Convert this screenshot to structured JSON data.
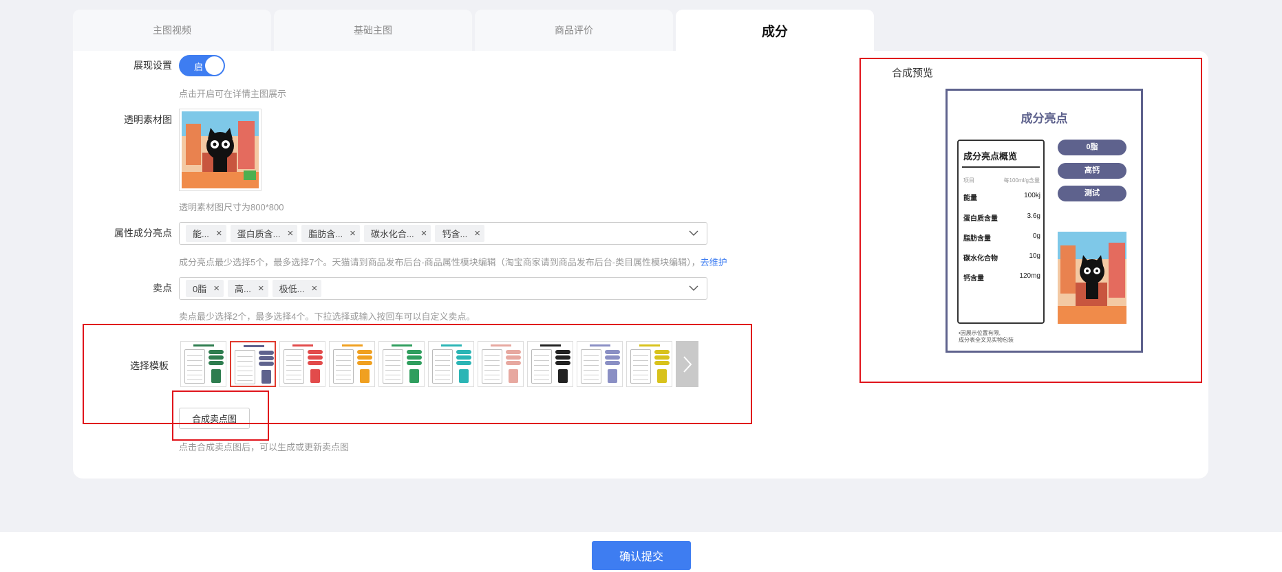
{
  "tabs": [
    {
      "label": "主图视频"
    },
    {
      "label": "基础主图"
    },
    {
      "label": "商品评价"
    },
    {
      "label": "成分",
      "active": true
    }
  ],
  "display": {
    "label": "展现设置",
    "toggle_text": "启",
    "toggle_on": true,
    "hint": "点击开启可在详情主图展示"
  },
  "asset": {
    "label": "透明素材图",
    "hint": "透明素材图尺寸为800*800"
  },
  "attributes": {
    "label": "属性成分亮点",
    "tags": [
      "能...",
      "蛋白质含...",
      "脂肪含...",
      "碳水化合...",
      "钙含..."
    ],
    "hint": "成分亮点最少选择5个，最多选择7个。天猫请到商品发布后台-商品属性模块编辑（淘宝商家请到商品发布后台-类目属性模块编辑），",
    "link": "去维护"
  },
  "selling": {
    "label": "卖点",
    "tags": [
      "0脂",
      "高...",
      "极低..."
    ],
    "hint": "卖点最少选择2个，最多选择4个。下拉选择或输入按回车可以自定义卖点。"
  },
  "template": {
    "label": "选择模板",
    "colors": [
      "#2e7d4f",
      "#5e628d",
      "#e24b4b",
      "#f0a020",
      "#2f9e5e",
      "#2bb5b5",
      "#e7a8a0",
      "#222222",
      "#8a8fc4",
      "#d8c21c"
    ],
    "selected_index": 1
  },
  "compose": {
    "button": "合成卖点图",
    "hint": "点击合成卖点图后，可以生成或更新卖点图"
  },
  "preview": {
    "title": "合成预览",
    "card_title": "成分亮点",
    "table_title": "成分亮点概览",
    "head_left": "项目",
    "head_right": "每100ml/g含量",
    "rows": [
      {
        "name": "能量",
        "value": "100kj"
      },
      {
        "name": "蛋白质含量",
        "value": "3.6g"
      },
      {
        "name": "脂肪含量",
        "value": "0g"
      },
      {
        "name": "碳水化合物",
        "value": "10g"
      },
      {
        "name": "钙含量",
        "value": "120mg"
      }
    ],
    "pills": [
      "0脂",
      "高钙",
      "测试"
    ],
    "foot1": "•因展示位置有限,",
    "foot2": "成分表全文见实物包装",
    "accent": "#5e628d"
  },
  "submit": {
    "label": "确认提交"
  },
  "colors": {
    "primary": "#3e7df1",
    "highlight": "#e0141b"
  }
}
